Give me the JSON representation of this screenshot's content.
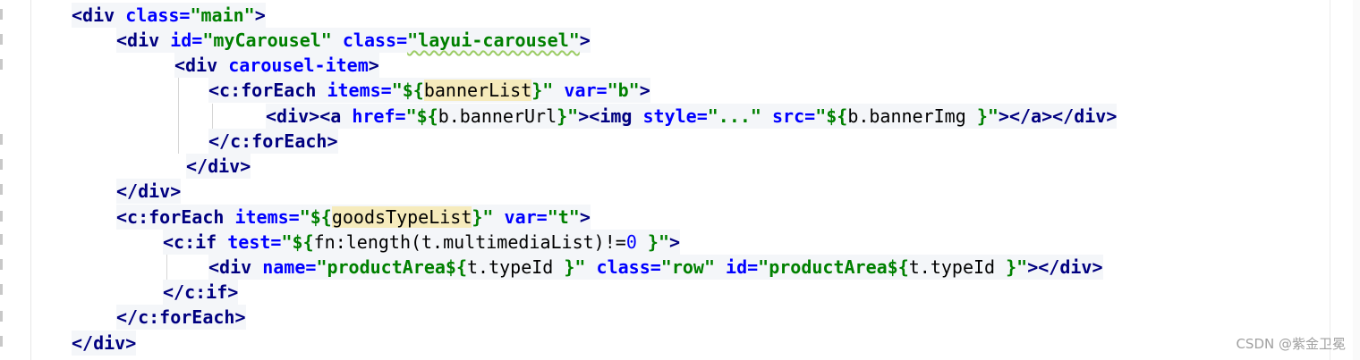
{
  "editor": {
    "lines": [
      {
        "tokens": [
          [
            "tag",
            "<div"
          ],
          [
            "sp",
            " "
          ],
          [
            "attr",
            "class="
          ],
          [
            "val",
            "\"main\""
          ],
          [
            "tag",
            ">"
          ]
        ]
      },
      {
        "tokens": [
          [
            "tag",
            "<div"
          ],
          [
            "sp",
            " "
          ],
          [
            "attr",
            "id="
          ],
          [
            "val",
            "\"myCarousel\""
          ],
          [
            "sp",
            " "
          ],
          [
            "attr",
            "class="
          ],
          [
            "val",
            "\"layui-carousel\""
          ],
          [
            "tag",
            ">"
          ]
        ]
      },
      {
        "tokens": [
          [
            "tag",
            "<div"
          ],
          [
            "sp",
            " "
          ],
          [
            "attr",
            "carousel-item"
          ],
          [
            "tag",
            ">"
          ]
        ]
      },
      {
        "tokens": [
          [
            "tag",
            "<c:forEach"
          ],
          [
            "sp",
            " "
          ],
          [
            "attr",
            "items="
          ],
          [
            "val",
            "\"${"
          ],
          [
            "hl",
            "bannerList"
          ],
          [
            "val",
            "}\""
          ],
          [
            "sp",
            " "
          ],
          [
            "attr",
            "var="
          ],
          [
            "val",
            "\"b\""
          ],
          [
            "tag",
            ">"
          ]
        ]
      },
      {
        "tokens": [
          [
            "tag",
            "<div><a"
          ],
          [
            "sp",
            " "
          ],
          [
            "attr",
            "href="
          ],
          [
            "val",
            "\"${"
          ],
          [
            "el",
            "b.bannerUrl"
          ],
          [
            "val",
            "}\""
          ],
          [
            "tag",
            "><img"
          ],
          [
            "sp",
            " "
          ],
          [
            "attr",
            "style="
          ],
          [
            "val",
            "\"...\""
          ],
          [
            "sp",
            " "
          ],
          [
            "attr",
            "src="
          ],
          [
            "val",
            "\"${"
          ],
          [
            "el",
            "b.bannerImg "
          ],
          [
            "val",
            "}\""
          ],
          [
            "tag",
            "></a></div>"
          ]
        ]
      },
      {
        "tokens": [
          [
            "tag",
            "</c:forEach>"
          ]
        ]
      },
      {
        "tokens": [
          [
            "tag",
            "</div>"
          ]
        ]
      },
      {
        "tokens": [
          [
            "tag",
            "</div>"
          ]
        ]
      },
      {
        "tokens": [
          [
            "tag",
            "<c:forEach"
          ],
          [
            "sp",
            " "
          ],
          [
            "attr",
            "items="
          ],
          [
            "val",
            "\"${"
          ],
          [
            "hl",
            "goodsTypeList"
          ],
          [
            "val",
            "}\""
          ],
          [
            "sp",
            " "
          ],
          [
            "attr",
            "var="
          ],
          [
            "val",
            "\"t\""
          ],
          [
            "tag",
            ">"
          ]
        ]
      },
      {
        "tokens": [
          [
            "tag",
            "<c:if"
          ],
          [
            "sp",
            " "
          ],
          [
            "attr",
            "test="
          ],
          [
            "val",
            "\"${"
          ],
          [
            "el",
            "fn:length(t.multimediaList)!="
          ],
          [
            "num",
            "0"
          ],
          [
            "el",
            " "
          ],
          [
            "val",
            "}\""
          ],
          [
            "tag",
            ">"
          ]
        ]
      },
      {
        "tokens": [
          [
            "tag",
            "<div"
          ],
          [
            "sp",
            " "
          ],
          [
            "attr",
            "name="
          ],
          [
            "val",
            "\"productArea${"
          ],
          [
            "el",
            "t.typeId "
          ],
          [
            "val",
            "}\""
          ],
          [
            "sp",
            " "
          ],
          [
            "attr",
            "class="
          ],
          [
            "val",
            "\"row\""
          ],
          [
            "sp",
            " "
          ],
          [
            "attr",
            "id="
          ],
          [
            "val",
            "\"productArea${"
          ],
          [
            "el",
            "t.typeId "
          ],
          [
            "val",
            "}\""
          ],
          [
            "tag",
            "></div>"
          ]
        ]
      },
      {
        "tokens": [
          [
            "tag",
            "</c:if>"
          ]
        ]
      },
      {
        "tokens": [
          [
            "tag",
            "</c:forEach>"
          ]
        ]
      },
      {
        "tokens": [
          [
            "tag",
            "</div>"
          ]
        ]
      }
    ]
  },
  "watermark": "CSDN @紫金卫冕"
}
